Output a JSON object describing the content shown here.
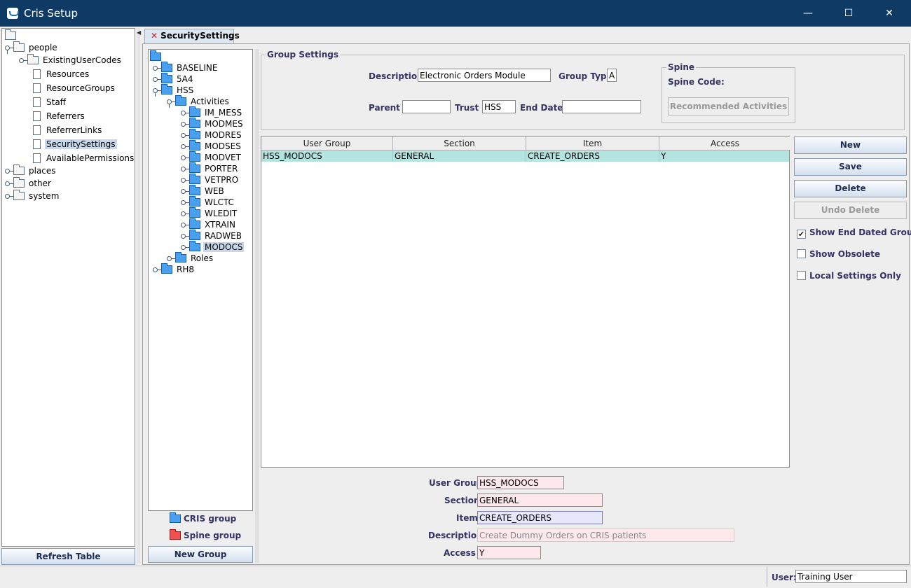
{
  "window": {
    "title": "Cris Setup",
    "minimize": "—",
    "maximize": "☐",
    "close": "✕"
  },
  "left_tree": {
    "items": [
      {
        "label": "people"
      },
      {
        "label": "ExistingUserCodes"
      },
      {
        "label": "Resources"
      },
      {
        "label": "ResourceGroups"
      },
      {
        "label": "Staff"
      },
      {
        "label": "Referrers"
      },
      {
        "label": "ReferrerLinks"
      },
      {
        "label": "SecuritySettings"
      },
      {
        "label": "AvailablePermissions"
      },
      {
        "label": "places"
      },
      {
        "label": "other"
      },
      {
        "label": "system"
      }
    ],
    "refresh_label": "Refresh Table"
  },
  "tab": {
    "label": "SecuritySettings",
    "close_glyph": "✕"
  },
  "group_tree": {
    "items": [
      {
        "label": "BASELINE"
      },
      {
        "label": "5A4"
      },
      {
        "label": "HSS"
      },
      {
        "label": "Activities"
      },
      {
        "label": "IM_MESS"
      },
      {
        "label": "MODMES"
      },
      {
        "label": "MODRES"
      },
      {
        "label": "MODSES"
      },
      {
        "label": "MODVET"
      },
      {
        "label": "PORTER"
      },
      {
        "label": "VETPRO"
      },
      {
        "label": "WEB"
      },
      {
        "label": "WLCTC"
      },
      {
        "label": "WLEDIT"
      },
      {
        "label": "XTRAIN"
      },
      {
        "label": "RADWEB"
      },
      {
        "label": "MODOCS"
      },
      {
        "label": "Roles"
      },
      {
        "label": "RH8"
      }
    ],
    "legend_cris": "CRIS group",
    "legend_spine": "Spine group",
    "new_group_label": "New Group"
  },
  "group_settings": {
    "title": "Group Settings",
    "description_label": "Description",
    "description_value": "Electronic Orders Module",
    "group_type_label": "Group Type",
    "group_type_value": "A",
    "parent_label": "Parent",
    "parent_value": "",
    "trust_label": "Trust",
    "trust_value": "HSS",
    "end_date_label": "End Date",
    "end_date_value": "",
    "spine": {
      "title": "Spine",
      "code_label": "Spine Code:",
      "recommended_label": "Recommended Activities"
    }
  },
  "table": {
    "columns": [
      "User Group",
      "Section",
      "Item",
      "Access"
    ],
    "rows": [
      [
        "HSS_MODOCS",
        "GENERAL",
        "CREATE_ORDERS",
        "Y"
      ]
    ]
  },
  "actions": {
    "new": "New",
    "save": "Save",
    "delete": "Delete",
    "undo_delete": "Undo Delete",
    "show_end_dated": "Show End Dated Groups",
    "show_obsolete": "Show Obsolete",
    "local_only": "Local Settings Only",
    "checkmark": "✔"
  },
  "detail": {
    "user_group_label": "User Group",
    "user_group_value": "HSS_MODOCS",
    "section_label": "Section",
    "section_value": "GENERAL",
    "item_label": "Item",
    "item_value": "CREATE_ORDERS",
    "description_label": "Description",
    "description_value": "Create Dummy Orders on CRIS patients",
    "access_label": "Access",
    "access_value": "Y"
  },
  "status": {
    "user_label": "User:",
    "user_value": "Training User"
  },
  "colors": {
    "titlebar": "#0e3a64",
    "selected_row": "#b2e4e0",
    "accent_text": "#333366"
  }
}
